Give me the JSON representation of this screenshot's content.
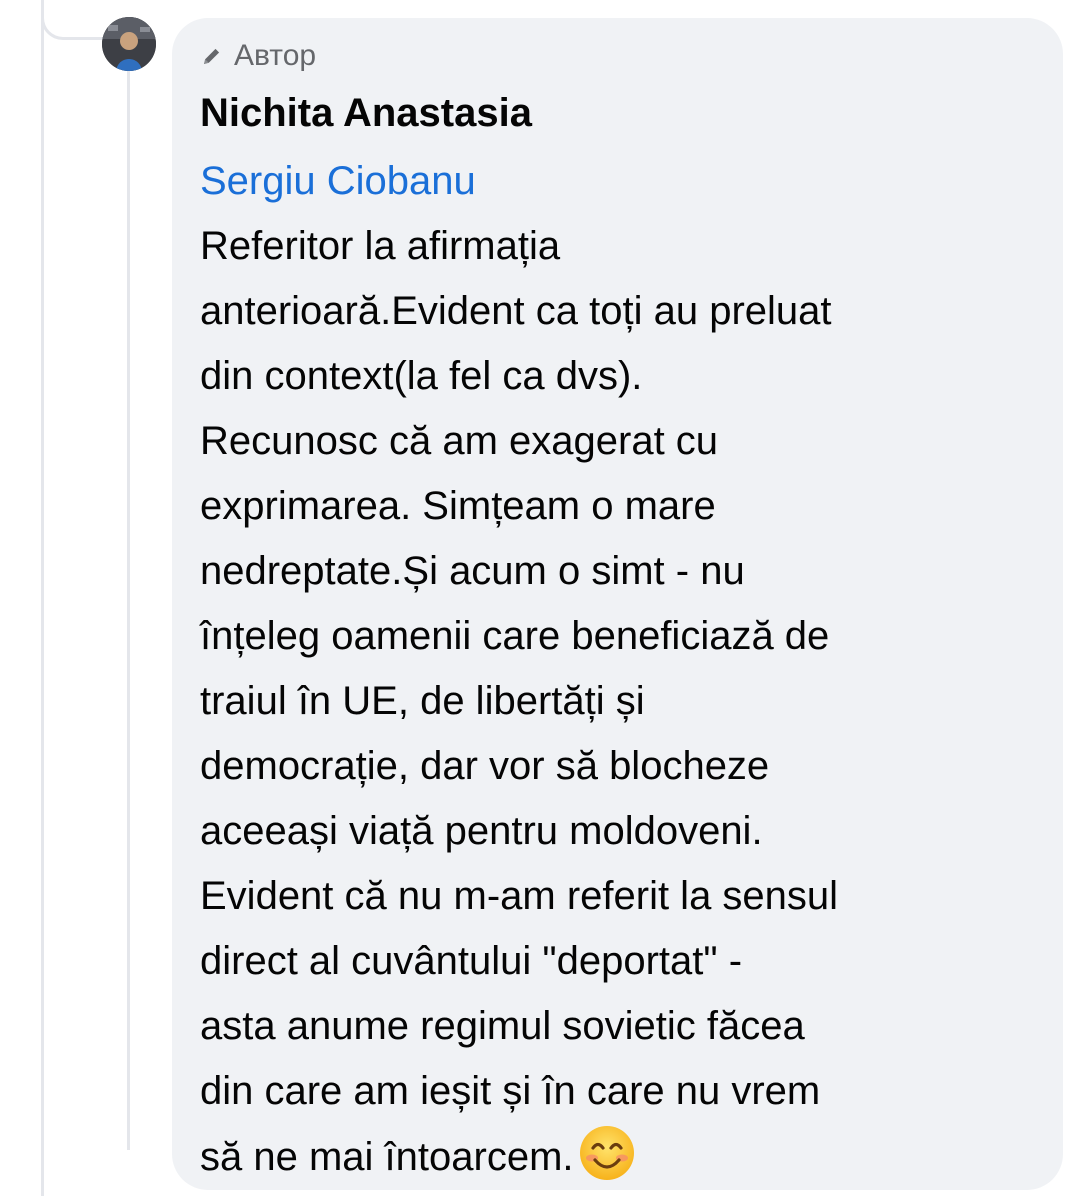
{
  "comment": {
    "badge": {
      "icon": "pencil-icon",
      "label": "Автор"
    },
    "author_name": "Nichita Anastasia",
    "mention": "Sergiu Ciobanu",
    "text_lines": [
      "Referitor la afirmația",
      "anterioară.Evident ca toți au preluat",
      "din context(la fel ca dvs).",
      "Recunosc că am exagerat cu",
      "exprimarea. Simțeam o mare",
      "nedreptate.Și acum o simt - nu",
      "înțeleg oamenii care beneficiază de",
      "traiul în UE, de libertăți și",
      "democrație, dar vor să blocheze",
      "aceeași viață pentru moldoveni.",
      "Evident că nu m-am referit la sensul",
      "direct al cuvântului \"deportat\" -",
      "asta anume regimul sovietic făcea",
      "din care am ieșit și în care nu vrem",
      "să ne mai întoarcem."
    ],
    "trailing_emoji": "smiling-face-with-smiling-eyes",
    "colors": {
      "bubble_background": "#f0f2f5",
      "mention_blue": "#1a6fd8",
      "badge_gray": "#65676b",
      "text": "#050505"
    }
  }
}
